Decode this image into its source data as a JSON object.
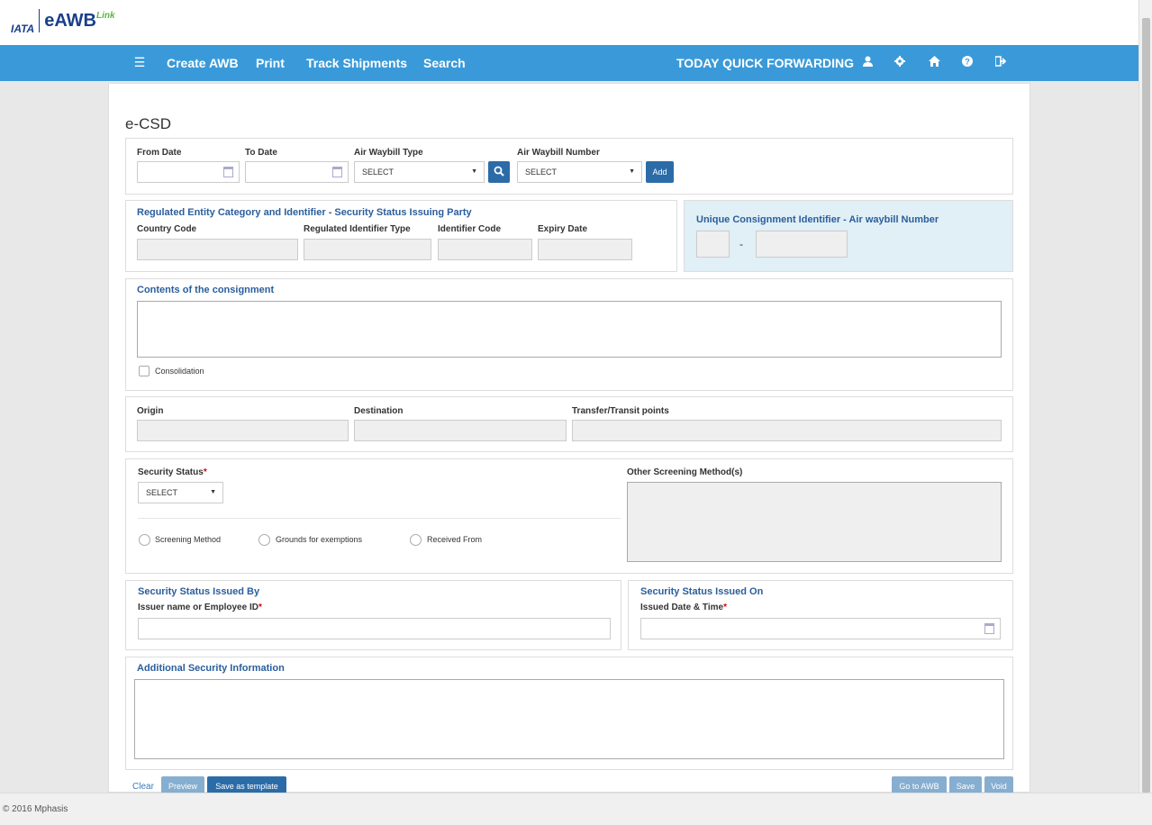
{
  "brand": {
    "iata": "IATA",
    "name_e": "eAWB",
    "name_link": "Link"
  },
  "nav": {
    "menu_icon": "hamburger-icon",
    "items": [
      "Create AWB",
      "Print",
      "Track Shipments",
      "Search"
    ],
    "company": "TODAY QUICK FORWARDING",
    "icons": [
      "user-icon",
      "gear-icon",
      "home-icon",
      "help-icon",
      "logout-icon"
    ]
  },
  "page": {
    "title": "e-CSD"
  },
  "search": {
    "from_date": "From Date",
    "to_date": "To Date",
    "awb_type": "Air Waybill Type",
    "awb_type_value": "SELECT",
    "awb_number": "Air Waybill Number",
    "awb_number_value": "SELECT",
    "add": "Add"
  },
  "regulated": {
    "title": "Regulated Entity Category and Identifier - Security Status Issuing Party",
    "country": "Country Code",
    "id_type": "Regulated Identifier Type",
    "id_code": "Identifier Code",
    "expiry": "Expiry Date"
  },
  "uci": {
    "title": "Unique Consignment Identifier - Air waybill Number",
    "dash": "-"
  },
  "contents": {
    "title": "Contents of the consignment",
    "consolidation": "Consolidation"
  },
  "route": {
    "origin": "Origin",
    "destination": "Destination",
    "transit": "Transfer/Transit points"
  },
  "security": {
    "status": "Security Status",
    "status_value": "SELECT",
    "other": "Other Screening Method(s)",
    "screening": "Screening Method",
    "grounds": "Grounds for exemptions",
    "received": "Received From",
    "req": "*"
  },
  "issued_by": {
    "title": "Security Status Issued By",
    "label": "Issuer name or Employee ID",
    "req": "*"
  },
  "issued_on": {
    "title": "Security Status Issued On",
    "label": "Issued Date & Time",
    "req": "*"
  },
  "additional": {
    "title": "Additional Security Information"
  },
  "actions": {
    "clear": "Clear",
    "preview": "Preview",
    "template": "Save as template",
    "goto": "Go to AWB",
    "save": "Save",
    "void": "Void"
  },
  "footer": {
    "copyright": "© 2016 Mphasis"
  }
}
